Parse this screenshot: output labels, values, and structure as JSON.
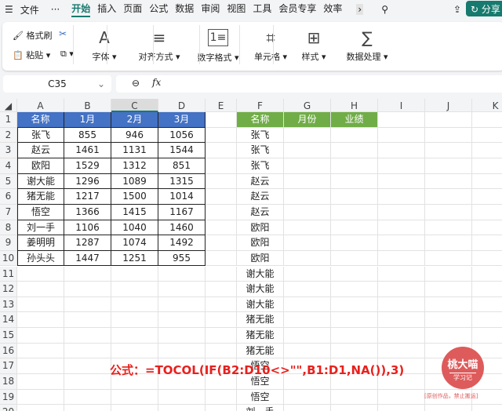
{
  "menu": {
    "icon": "menu-icon",
    "file": "文件",
    "more": "···",
    "tabs": [
      "开始",
      "插入",
      "页面",
      "公式",
      "数据",
      "审阅",
      "视图",
      "工具",
      "会员专享",
      "效率"
    ],
    "active": "开始",
    "share": "分享"
  },
  "ribbon": {
    "format_painter": "格式刷",
    "paste": "粘贴",
    "font": "字体",
    "align": "对齐方式",
    "number_format": "数字格式",
    "cell": "单元格",
    "style": "样式",
    "data_process": "数据处理"
  },
  "namebox": "C35",
  "formula_bar": {
    "fx": "fx",
    "value": ""
  },
  "columns": [
    "A",
    "B",
    "C",
    "D",
    "E",
    "F",
    "G",
    "H",
    "I",
    "J",
    "K"
  ],
  "selected_column": "C",
  "rows": [
    "1",
    "2",
    "3",
    "4",
    "5",
    "6",
    "7",
    "8",
    "9",
    "10",
    "11",
    "12",
    "13",
    "14",
    "15",
    "16",
    "17",
    "18",
    "19",
    "20"
  ],
  "table1": {
    "headers": [
      "名称",
      "1月",
      "2月",
      "3月"
    ],
    "rows": [
      [
        "张飞",
        "855",
        "946",
        "1056"
      ],
      [
        "赵云",
        "1461",
        "1131",
        "1544"
      ],
      [
        "欧阳",
        "1529",
        "1312",
        "851"
      ],
      [
        "谢大能",
        "1296",
        "1089",
        "1315"
      ],
      [
        "猪无能",
        "1217",
        "1500",
        "1014"
      ],
      [
        "悟空",
        "1366",
        "1415",
        "1167"
      ],
      [
        "刘一手",
        "1106",
        "1040",
        "1460"
      ],
      [
        "姜明明",
        "1287",
        "1074",
        "1492"
      ],
      [
        "孙头头",
        "1447",
        "1251",
        "955"
      ]
    ]
  },
  "table2": {
    "headers": [
      "名称",
      "月份",
      "业绩"
    ],
    "names": [
      "张飞",
      "张飞",
      "张飞",
      "赵云",
      "赵云",
      "赵云",
      "欧阳",
      "欧阳",
      "欧阳",
      "谢大能",
      "谢大能",
      "谢大能",
      "猪无能",
      "猪无能",
      "猪无能",
      "悟空",
      "悟空",
      "悟空",
      "刘一手"
    ]
  },
  "colors": {
    "header_blue": "#4472c4",
    "header_green": "#70ad47",
    "accent": "#167a6e",
    "formula_red": "#e8201c"
  },
  "annotation": "公式：=TOCOL(IF(B2:D10<>\"\",B1:D1,NA()),3)",
  "watermark": {
    "title": "桃大喵",
    "sub": "学习记",
    "note": "[原创作品，禁止搬运]"
  }
}
